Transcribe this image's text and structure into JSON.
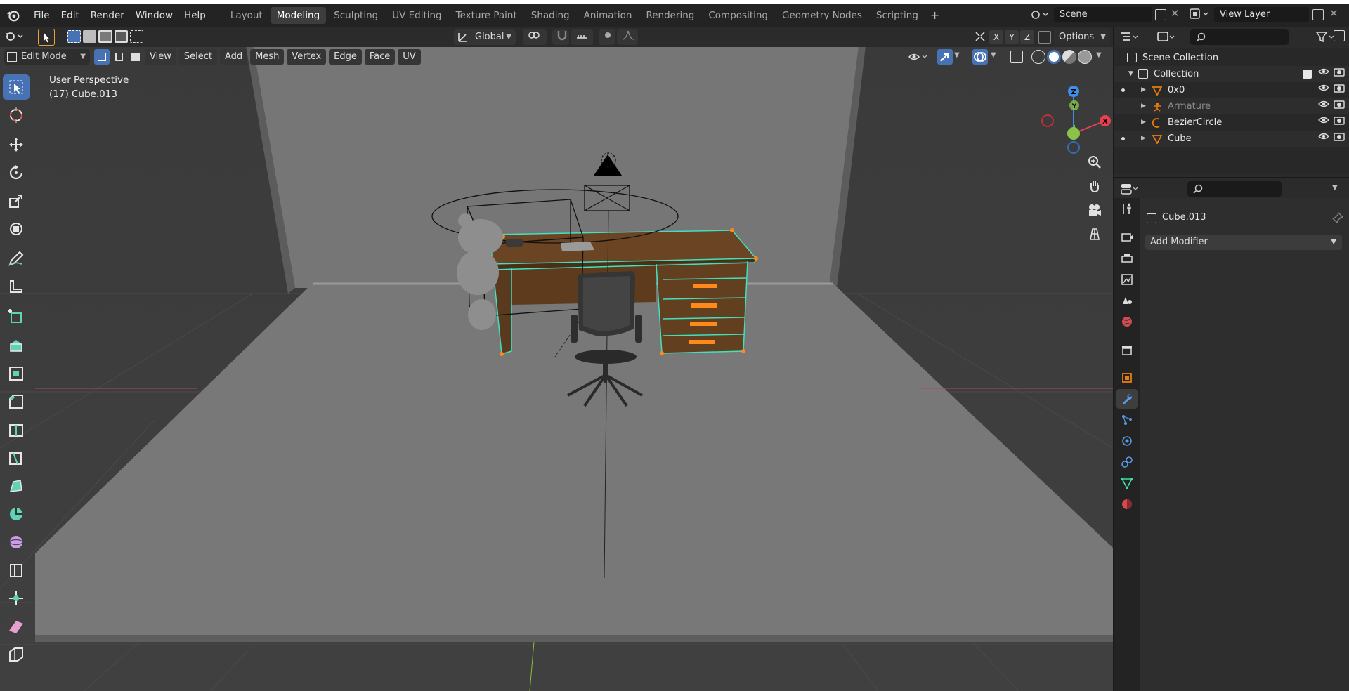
{
  "topbar": {
    "menus": [
      "File",
      "Edit",
      "Render",
      "Window",
      "Help"
    ],
    "workspaces": [
      "Layout",
      "Modeling",
      "Sculpting",
      "UV Editing",
      "Texture Paint",
      "Shading",
      "Animation",
      "Rendering",
      "Compositing",
      "Geometry Nodes",
      "Scripting"
    ],
    "active_workspace": "Modeling",
    "add_tab": "+",
    "scene": "Scene",
    "view_layer": "View Layer"
  },
  "tool_header": {
    "orientation": "Global",
    "options": "Options",
    "axes": [
      "X",
      "Y",
      "Z"
    ]
  },
  "viewport_header": {
    "mode": "Edit Mode",
    "menus": [
      "View",
      "Select",
      "Add",
      "Mesh",
      "Vertex",
      "Edge",
      "Face",
      "UV"
    ]
  },
  "viewport": {
    "perspective_label": "User Perspective",
    "object_label": "(17) Cube.013",
    "gizmo_axes": [
      "Z",
      "Y",
      "X"
    ]
  },
  "outliner": {
    "scene_collection": "Scene Collection",
    "collection": "Collection",
    "items": [
      {
        "name": "0x0",
        "icon": "mesh-icon",
        "dimmed": false
      },
      {
        "name": "Armature",
        "icon": "armature-icon",
        "dimmed": true
      },
      {
        "name": "BezierCircle",
        "icon": "curve-icon",
        "dimmed": false
      },
      {
        "name": "Cube",
        "icon": "mesh-icon",
        "dimmed": false
      }
    ]
  },
  "properties": {
    "object_name": "Cube.013",
    "add_modifier": "Add Modifier"
  },
  "colors": {
    "accent": "#4772b3",
    "active_object": "#e87d0d",
    "mesh_edge": "#40e0c0",
    "desk_wood": "#5a3a1e",
    "axis_x": "#e8404e",
    "axis_y": "#8bc34a",
    "axis_z": "#3d8fe8"
  }
}
